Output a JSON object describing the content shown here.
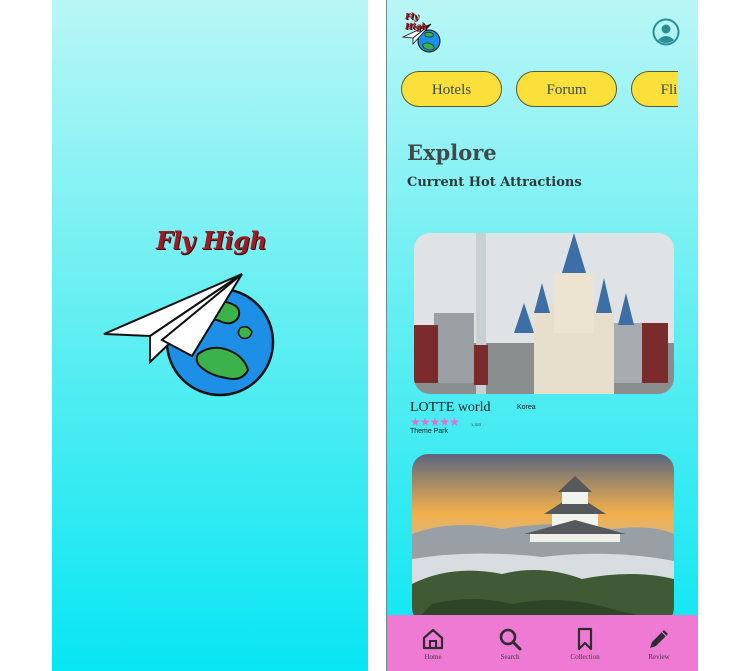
{
  "splash": {
    "brand": "Fly High",
    "logo_icon": "paper-plane-globe-icon"
  },
  "home": {
    "brand": "Fly High",
    "logo_icon": "paper-plane-globe-icon",
    "account_icon": "user-account-icon",
    "chips": [
      {
        "label": "Hotels"
      },
      {
        "label": "Forum"
      },
      {
        "label": "Flights"
      }
    ],
    "explore": {
      "title": "Explore",
      "subtitle": "Current Hot Attractions"
    },
    "attractions": [
      {
        "name": "LOTTE world",
        "country": "Korea",
        "rating": 4.5,
        "rating_stars": "★★★★★",
        "review_count": "1,323",
        "category": "Theme Park",
        "image": "lotte-world-castle-photo"
      },
      {
        "name": "",
        "image": "himeji-castle-photo"
      }
    ],
    "nav": [
      {
        "label": "Home",
        "icon": "home-icon"
      },
      {
        "label": "Search",
        "icon": "search-icon"
      },
      {
        "label": "Collection",
        "icon": "bookmark-icon"
      },
      {
        "label": "Review",
        "icon": "pencil-icon"
      }
    ]
  },
  "colors": {
    "background_top": "#b9f6f6",
    "background_bottom": "#07e6f3",
    "chip": "#fbdf3b",
    "nav_bar": "#ef7ad4",
    "brand_text": "#a01a22",
    "stars": "#e06fd0"
  }
}
